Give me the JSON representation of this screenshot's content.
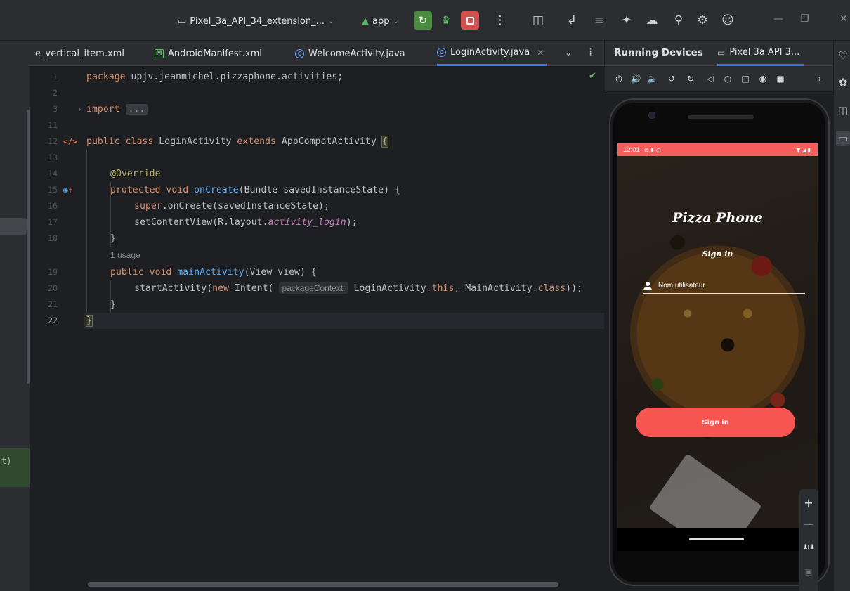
{
  "toolbar": {
    "device_name": "Pixel_3a_API_34_extension_...",
    "run_config": "app",
    "icons": [
      "device-icon",
      "android-app-icon",
      "chevron-down-icon",
      "rerun-icon",
      "debug-icon",
      "stop-icon",
      "more-icon",
      "layout-inspector-icon",
      "apply-changes-icon",
      "sync-icon",
      "profiler-icon",
      "device-manager-icon",
      "search-icon",
      "settings-icon",
      "account-icon",
      "minimize-icon",
      "restore-icon",
      "close-icon"
    ]
  },
  "left_panel": {
    "truncated_text": "t)"
  },
  "editor_tabs": [
    {
      "label": "e_vertical_item.xml",
      "icon": "none",
      "active": false
    },
    {
      "label": "AndroidManifest.xml",
      "icon": "manifest-icon",
      "active": false
    },
    {
      "label": "WelcomeActivity.java",
      "icon": "class-icon",
      "active": false
    },
    {
      "label": "LoginActivity.java",
      "icon": "class-icon",
      "active": true
    }
  ],
  "editor": {
    "file_status": "no-problems-check",
    "current_line": 22,
    "line_numbers": [
      "1",
      "2",
      "3",
      "11",
      "12",
      "13",
      "14",
      "15",
      "16",
      "17",
      "18",
      "19",
      "20",
      "21",
      "22"
    ],
    "code": {
      "package_kw": "package",
      "package_name": " upjv.jeanmichel.pizzaphone.activities;",
      "import_kw": "import",
      "import_fold": "...",
      "class_mods": "public class",
      "class_name": " LoginActivity ",
      "extends_kw": "extends",
      "class_parent": " AppCompatActivity ",
      "open_brace": "{",
      "annotation": "@Override",
      "oncreate_mods": "protected void",
      "oncreate_name": "onCreate",
      "oncreate_params": "(Bundle savedInstanceState) {",
      "super_kw": "super",
      "super_rest": ".onCreate(savedInstanceState);",
      "setcontent_pre": "setContentView(R.layout.",
      "setcontent_const": "activity_login",
      "setcontent_post": ");",
      "close_brace": "}",
      "usage_hint": "1 usage",
      "main_mods": "public void",
      "main_name": "mainActivity",
      "main_params": "(View view) {",
      "start_pre": "startActivity(",
      "new_kw": "new",
      "intent_txt": " Intent( ",
      "param_hint": "packageContext:",
      "login_ref": " LoginActivity.",
      "this_kw": "this",
      "main_ref": ", MainActivity.",
      "class_kw": "class",
      "end_call": "));",
      "class_close": "}"
    }
  },
  "running_devices": {
    "title": "Running Devices",
    "device_tab": "Pixel 3a API 3...",
    "controls": [
      "power-icon",
      "volume-up-icon",
      "volume-down-icon",
      "rotate-left-icon",
      "rotate-right-icon",
      "back-icon",
      "home-icon",
      "overview-icon",
      "screenshot-icon",
      "screen-record-icon",
      "chevron-right-icon"
    ],
    "zoom": {
      "plus": "+",
      "minus": "—",
      "one_to_one": "1:1",
      "fit": "fit-icon"
    }
  },
  "phone": {
    "status_time": "12:01",
    "app_title": "Pizza Phone",
    "subtitle": "Sign in",
    "username_placeholder": "Nom utilisateur",
    "signin_button": "Sign in",
    "accent_color": "#f75552"
  },
  "colors": {
    "editor_bg": "#1e1f22",
    "toolbar_bg": "#2b2d30",
    "keyword": "#cf8e6d",
    "function": "#56a8f5",
    "annotation": "#b3ae60",
    "constant": "#c77dbb",
    "accent_blue": "#3574f0",
    "run_green": "#4b8b3f",
    "stop_red": "#d2504d"
  }
}
